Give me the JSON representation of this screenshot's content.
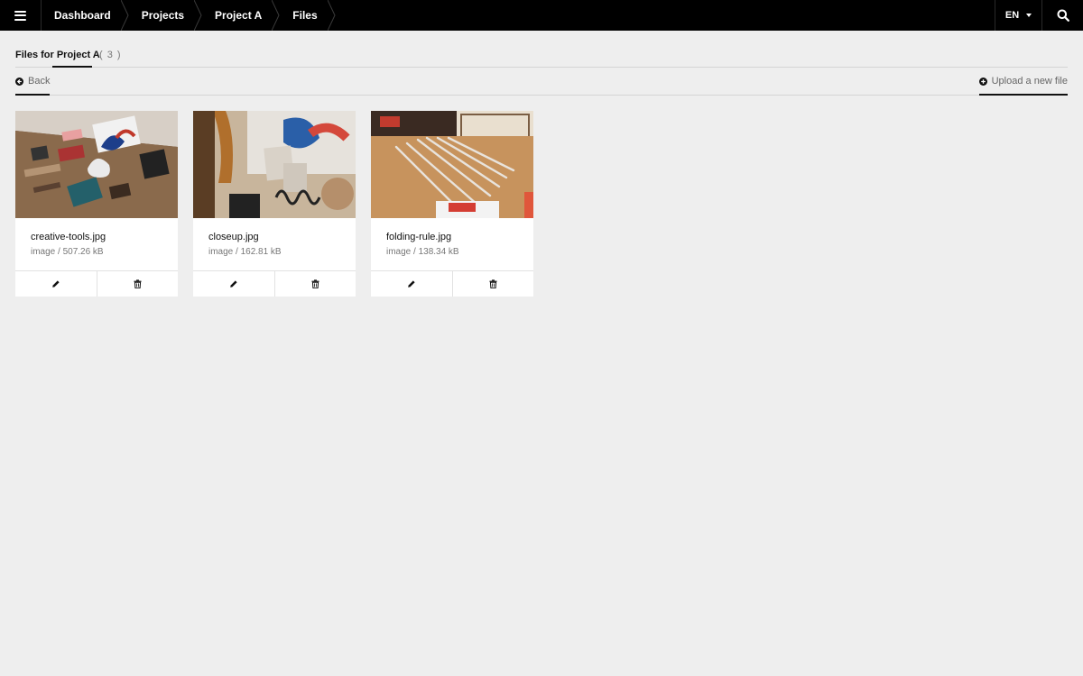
{
  "topbar": {
    "breadcrumb": [
      "Dashboard",
      "Projects",
      "Project A",
      "Files"
    ],
    "language": "EN"
  },
  "tabs": {
    "active_label": "Files for Project A",
    "count": "( 3 )"
  },
  "actions": {
    "back_label": "Back",
    "upload_label": "Upload a new file"
  },
  "files": [
    {
      "name": "creative-tools.jpg",
      "meta": "image / 507.26 kB",
      "thumbnail": "photo of design tools and stationery on a wooden desk"
    },
    {
      "name": "closeup.jpg",
      "meta": "image / 162.81 kB",
      "thumbnail": "close-up photo of wooden letters, spring and graphics"
    },
    {
      "name": "folding-rule.jpg",
      "meta": "image / 138.34 kB",
      "thumbnail": "photo of pencils, ruler and vintage signage on wood"
    }
  ],
  "icons": {
    "menu": "hamburger-icon",
    "search": "search-icon",
    "back": "arrow-left-circle-icon",
    "upload": "plus-circle-icon",
    "edit": "pencil-icon",
    "delete": "trash-icon"
  }
}
